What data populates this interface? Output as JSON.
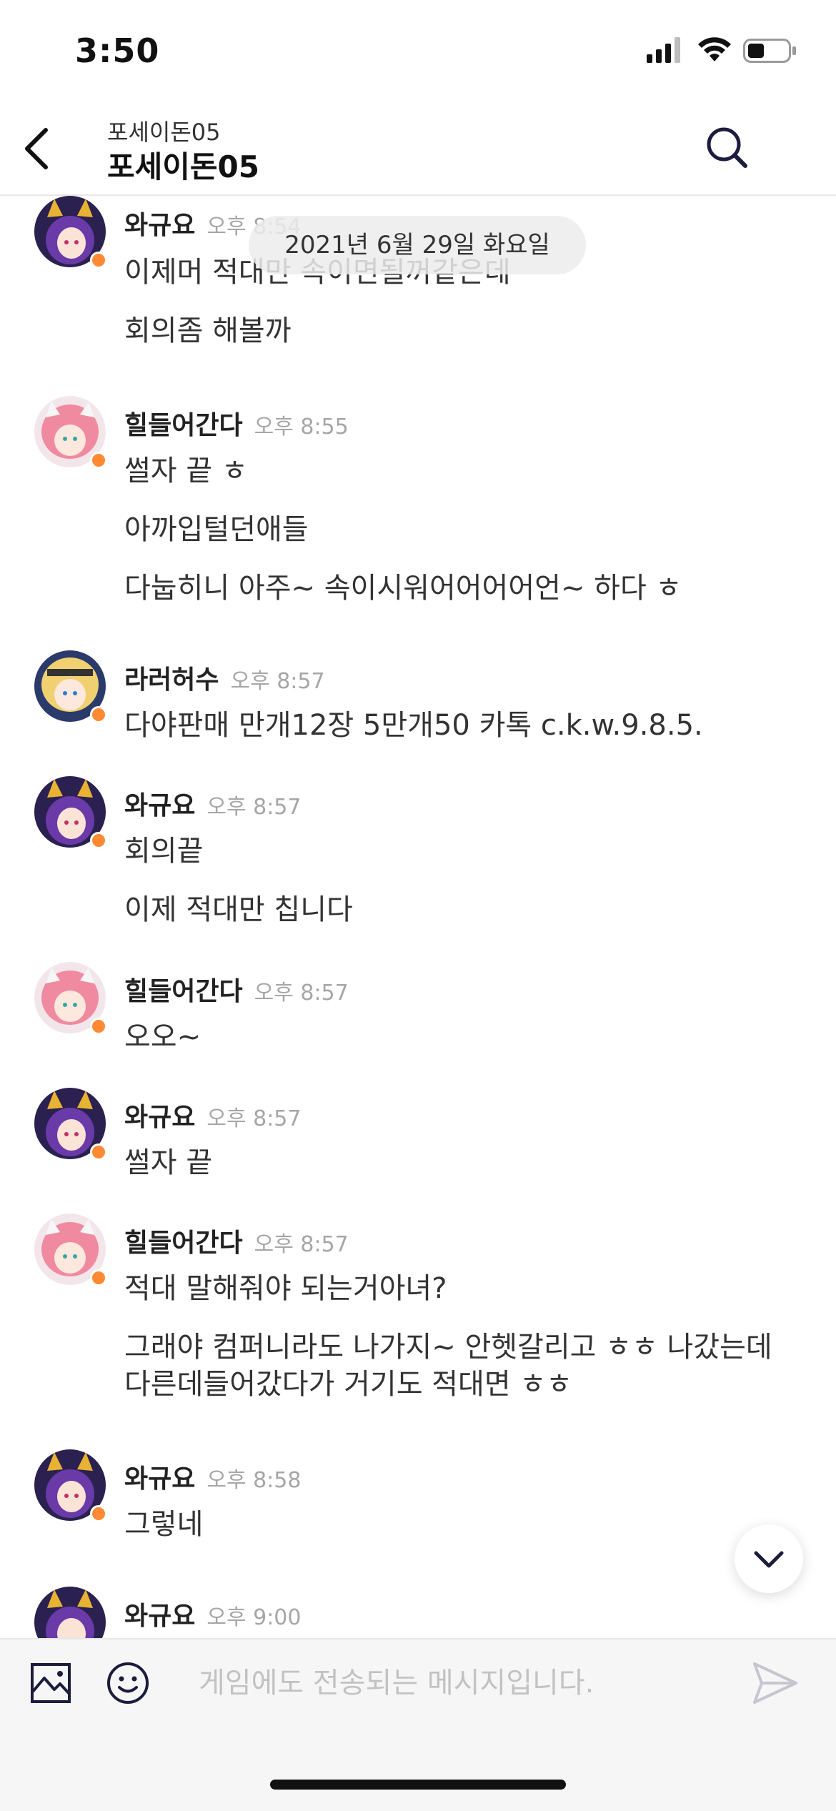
{
  "status_bar": {
    "time": "3:50"
  },
  "header": {
    "subtitle": "포세이돈05",
    "title": "포세이돈05"
  },
  "date_divider": "2021년 6월 29일 화요일",
  "messages": [
    {
      "sender": "와규요",
      "time": "오후 8:54",
      "avatar": "purple-cat-girl",
      "lines": [
        "이제머 적대만 속이면될꺼같은데",
        "회의좀 해볼까"
      ]
    },
    {
      "sender": "힐들어간다",
      "time": "오후 8:55",
      "avatar": "pink-hair-girl",
      "lines": [
        "썰자 끝 ㅎ",
        "아까입털던애들",
        "다눕히니 아주~ 속이시워어어어어언~ 하다 ㅎ"
      ]
    },
    {
      "sender": "라러허수",
      "time": "오후 8:57",
      "avatar": "blonde-tiger-boy",
      "lines": [
        "다야판매  만개12장 5만개50 카톡  c.k.w.9.8.5."
      ]
    },
    {
      "sender": "와규요",
      "time": "오후 8:57",
      "avatar": "purple-cat-girl",
      "lines": [
        "회의끝",
        "이제 적대만 칩니다"
      ]
    },
    {
      "sender": "힐들어간다",
      "time": "오후 8:57",
      "avatar": "pink-hair-girl",
      "lines": [
        "오오~"
      ]
    },
    {
      "sender": "와규요",
      "time": "오후 8:57",
      "avatar": "purple-cat-girl",
      "lines": [
        "썰자 끝"
      ]
    },
    {
      "sender": "힐들어간다",
      "time": "오후 8:57",
      "avatar": "pink-hair-girl",
      "lines": [
        "적대 말해줘야 되는거아녀?",
        "그래야 컴퍼니라도 나가지~ 안헷갈리고 ㅎㅎ 나갔는데",
        "다른데들어갔다가 거기도 적대면 ㅎㅎ"
      ]
    },
    {
      "sender": "와규요",
      "time": "오후 8:58",
      "avatar": "purple-cat-girl",
      "lines": [
        "그렇네"
      ]
    },
    {
      "sender": "와규요",
      "time": "오후 9:00",
      "avatar": "purple-cat-girl",
      "lines": []
    }
  ],
  "input": {
    "placeholder": "게임에도 전송되는 메시지입니다.",
    "value": ""
  },
  "colors": {
    "online_dot": "#ff8a33",
    "timestamp": "#a6a6a6",
    "accent": "#1c1c3c"
  },
  "icons": [
    "back-icon",
    "search-icon",
    "image-icon",
    "emoji-icon",
    "send-icon",
    "chevron-down-icon"
  ]
}
